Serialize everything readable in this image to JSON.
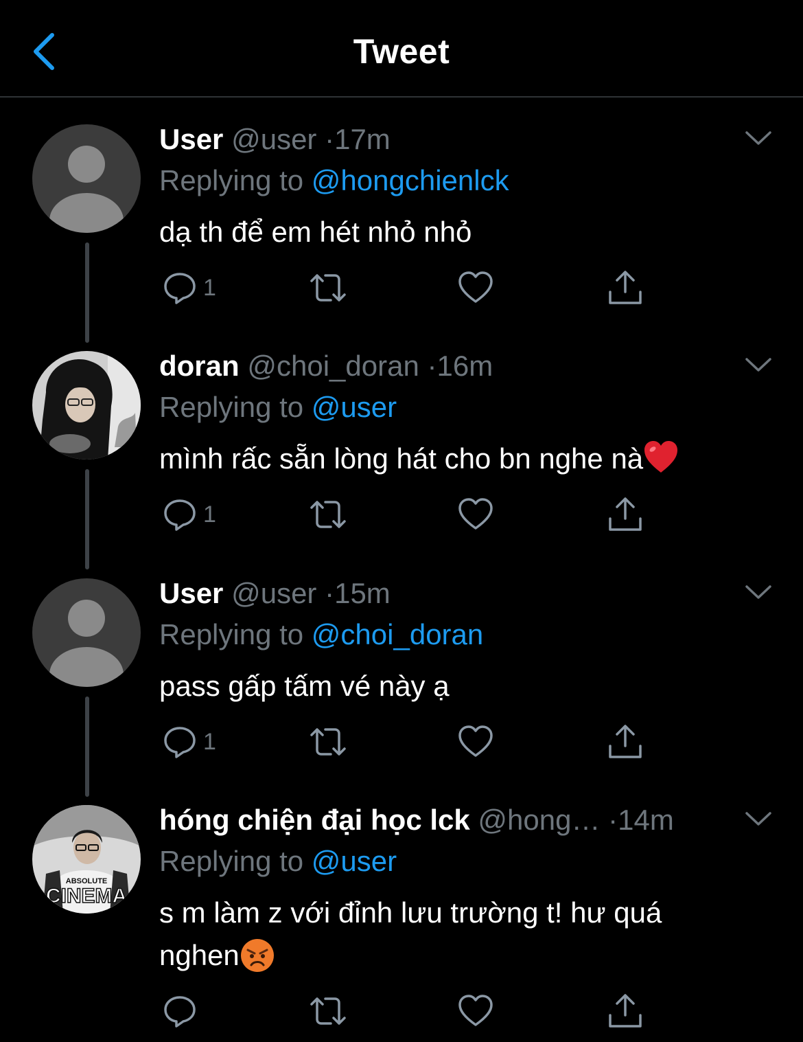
{
  "header": {
    "title": "Tweet"
  },
  "tweets": [
    {
      "name": "User",
      "handle": "@user",
      "separator": "·",
      "time": "17m",
      "replying_prefix": "Replying to",
      "replying_to": "@hongchienlck",
      "text": "dạ th để em hét nhỏ nhỏ",
      "reply_count": "1",
      "avatar": "default-avatar"
    },
    {
      "name": "doran",
      "handle": "@choi_doran",
      "separator": "·",
      "time": "16m",
      "replying_prefix": "Replying to",
      "replying_to": "@user",
      "text": "mình rấc sẵn lòng hát cho bn nghe nà",
      "text_emoji": "red-heart-emoji",
      "reply_count": "1",
      "avatar": "photo-hooded-person"
    },
    {
      "name": "User",
      "handle": "@user",
      "separator": "·",
      "time": "15m",
      "replying_prefix": "Replying to",
      "replying_to": "@choi_doran",
      "text": "pass gấp tấm vé này ạ",
      "reply_count": "1",
      "avatar": "default-avatar"
    },
    {
      "name": "hóng chiện đại học lck",
      "handle": "@hong…",
      "separator": "·",
      "time": "14m",
      "replying_prefix": "Replying to",
      "replying_to": "@user",
      "text": "s m làm z với đỉnh lưu trường t! hư quá nghen",
      "text_emoji": "angry-face-emoji",
      "reply_count": "",
      "avatar": "photo-absolute-cinema",
      "avatar_text_top": "ABSOLUTE",
      "avatar_text_bottom": "CINEMA"
    }
  ],
  "colors": {
    "accent": "#1d9bf0",
    "muted": "#6e767d",
    "background": "#000000",
    "divider": "#2f3336"
  }
}
